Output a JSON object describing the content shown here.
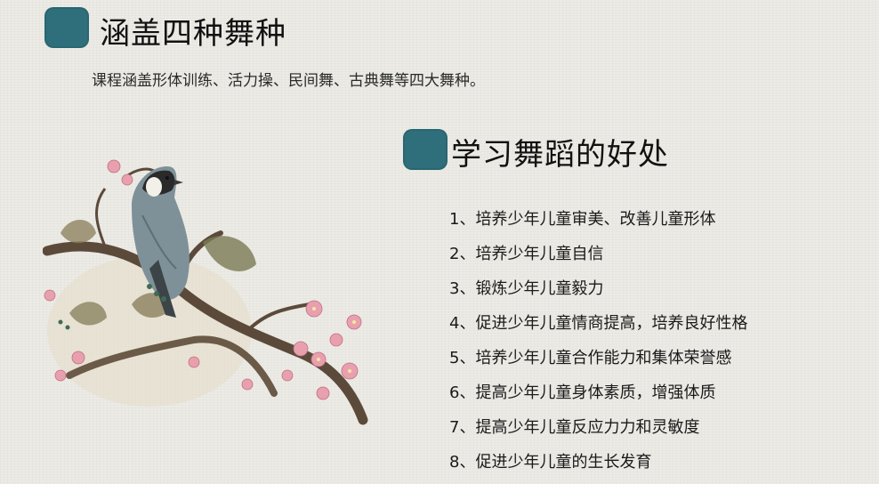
{
  "section1": {
    "title": "涵盖四种舞种",
    "description": "课程涵盖形体训练、活力操、民间舞、古典舞等四大舞种。"
  },
  "section2": {
    "title": "学习舞蹈的好处",
    "items": [
      "1、培养少年儿童审美、改善儿童形体",
      "2、培养少年儿童自信",
      "3、锻炼少年儿童毅力",
      "4、促进少年儿童情商提高，培养良好性格",
      "5、培养少年儿童合作能力和集体荣誉感",
      "6、提高少年儿童身体素质，增强体质",
      "7、提高少年儿童反应力力和灵敏度",
      "8、促进少年儿童的生长发育"
    ]
  },
  "colors": {
    "accent_square": "#2e6f7b",
    "background": "#ecebe6"
  },
  "illustration": {
    "icon": "bird-on-blossom-branch-painting"
  }
}
